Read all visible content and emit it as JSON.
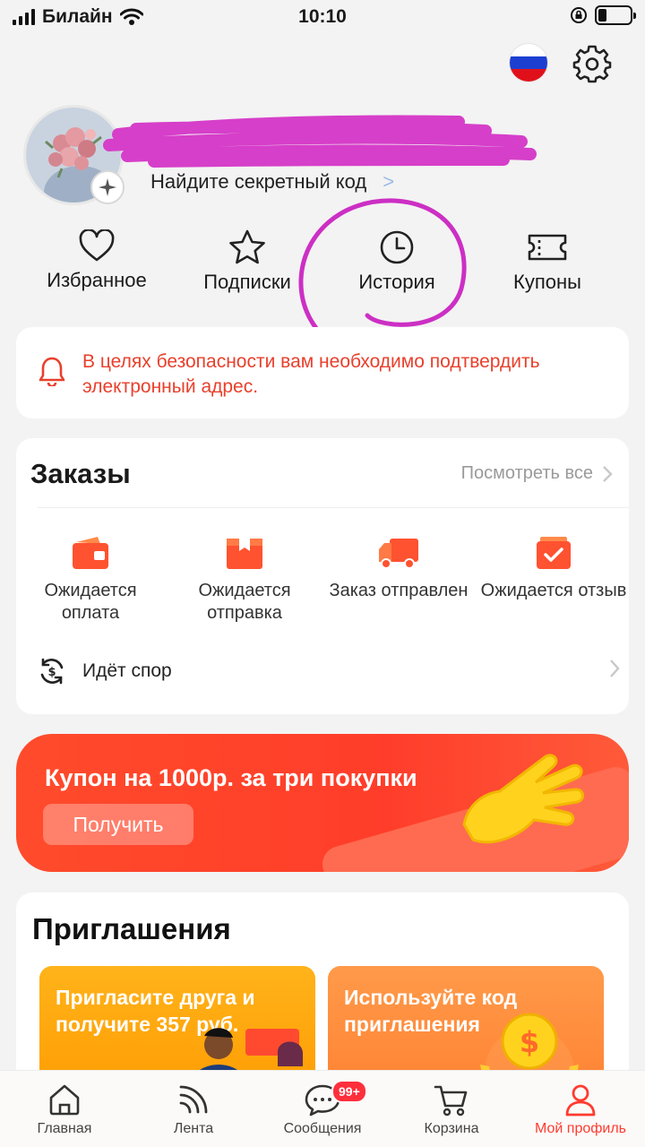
{
  "status_bar": {
    "carrier": "Билайн",
    "time": "10:10",
    "battery_level": 0.25
  },
  "header": {
    "flag_colors": [
      "#ffffff",
      "#1c3fd1",
      "#e0101a"
    ],
    "secret_code_link": "Найдите секретный код",
    "secret_code_chevron": ">"
  },
  "quick_actions": [
    {
      "icon": "heart-icon",
      "label": "Избранное"
    },
    {
      "icon": "star-icon",
      "label": "Подписки"
    },
    {
      "icon": "clock-icon",
      "label": "История"
    },
    {
      "icon": "ticket-icon",
      "label": "Купоны"
    }
  ],
  "security_notice": {
    "icon": "bell-icon",
    "text": "В целях безопасности вам необходимо подтвердить электронный адрес."
  },
  "orders": {
    "title": "Заказы",
    "view_all": "Посмотреть все",
    "statuses": [
      {
        "icon": "wallet-icon",
        "label": "Ожидается оплата"
      },
      {
        "icon": "package-icon",
        "label": "Ожидается отправка"
      },
      {
        "icon": "truck-icon",
        "label": "Заказ отправлен"
      },
      {
        "icon": "review-check-icon",
        "label": "Ожидается отзыв"
      }
    ],
    "dispute": "Идёт спор"
  },
  "promo": {
    "headline": "Купон на 1000р. за три покупки",
    "button": "Получить"
  },
  "invitations": {
    "title": "Приглашения",
    "cards": [
      {
        "text": "Пригласите друга и получите 357 руб."
      },
      {
        "text": "Используйте код приглашения"
      }
    ]
  },
  "tab_bar": {
    "items": [
      {
        "icon": "home-icon",
        "label": "Главная"
      },
      {
        "icon": "feed-icon",
        "label": "Лента"
      },
      {
        "icon": "chat-icon",
        "label": "Сообщения",
        "badge": "99+"
      },
      {
        "icon": "cart-icon",
        "label": "Корзина"
      },
      {
        "icon": "profile-icon",
        "label": "Мой профиль"
      }
    ],
    "active_color": "#ff3b30"
  },
  "colors": {
    "accent": "#ff3b30",
    "orange": "#ff6a2a"
  }
}
